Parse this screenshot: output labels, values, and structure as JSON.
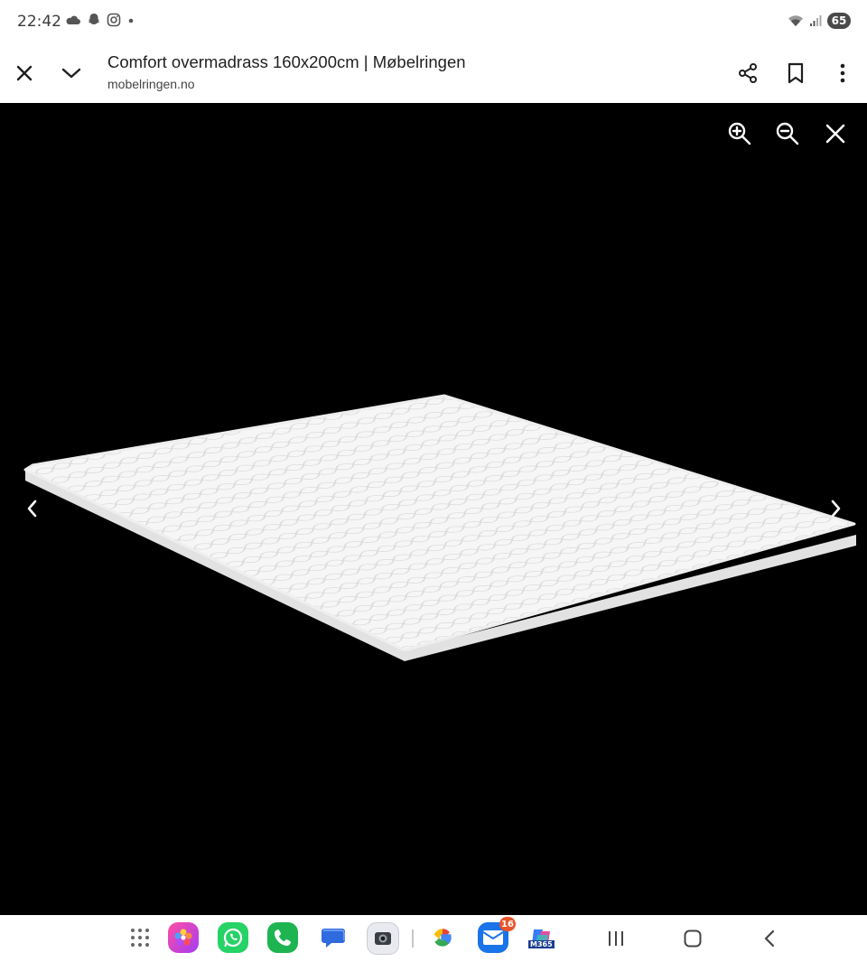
{
  "status_bar": {
    "time": "22:42",
    "left_icons": [
      "cloud-icon",
      "snapchat-icon",
      "instagram-icon",
      "dot-icon"
    ],
    "right_icons": [
      "wifi-icon",
      "signal-icon"
    ],
    "battery": "65"
  },
  "toolbar": {
    "title": "Comfort overmadrass 160x200cm | Møbelringen",
    "url": "mobelringen.no",
    "buttons": [
      "close-icon",
      "chevron-down-icon",
      "share-icon",
      "bookmark-icon",
      "more-vert-icon"
    ]
  },
  "viewer": {
    "background": "#000000",
    "controls": [
      "zoom-in-icon",
      "zoom-out-icon",
      "close-icon",
      "chevron-left-icon",
      "chevron-right-icon"
    ],
    "image": "white quilted mattress topper"
  },
  "dock": {
    "apps": [
      "apps-grid-icon",
      "photos-app-icon",
      "whatsapp-icon",
      "phone-icon",
      "messages-icon",
      "camera-icon",
      "google-icon",
      "outlook-icon",
      "copilot-icon"
    ],
    "outlook_badge": "16",
    "copilot_label": "M365"
  },
  "system_nav": [
    "recents-icon",
    "home-icon",
    "back-icon"
  ]
}
